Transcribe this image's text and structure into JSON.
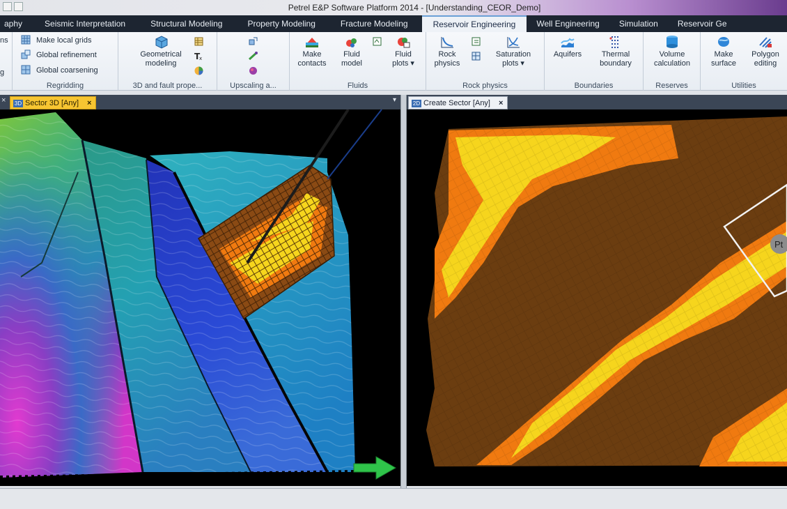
{
  "window": {
    "title": "Petrel E&P Software Platform 2014 - [Understanding_CEOR_Demo]"
  },
  "tabs": [
    {
      "label": "aphy",
      "x": 0,
      "active": false
    },
    {
      "label": "Seismic Interpretation",
      "active": false
    },
    {
      "label": "Structural Modeling",
      "active": false
    },
    {
      "label": "Property Modeling",
      "active": false
    },
    {
      "label": "Fracture Modeling",
      "active": false
    },
    {
      "label": "Reservoir Engineering",
      "active": true
    },
    {
      "label": "Well Engineering",
      "active": false
    },
    {
      "label": "Simulation",
      "active": false
    },
    {
      "label": "Reservoir Ge",
      "active": false
    }
  ],
  "ribbon": {
    "left_cut_labels": [
      "ns",
      "g"
    ],
    "regridding": {
      "label": "Regridding",
      "items": [
        "Make local grids",
        "Global refinement",
        "Global coarsening"
      ]
    },
    "fault": {
      "label": "3D and fault prope...",
      "button": "Geometrical modeling"
    },
    "upscaling": {
      "label": "Upscaling a..."
    },
    "fluids": {
      "label": "Fluids",
      "buttons": [
        "Make contacts",
        "Fluid model",
        "Fluid plots"
      ]
    },
    "rock": {
      "label": "Rock physics",
      "buttons": [
        "Rock physics",
        "Saturation plots"
      ]
    },
    "boundaries": {
      "label": "Boundaries",
      "buttons": [
        "Aquifers",
        "Thermal boundary"
      ]
    },
    "reserves": {
      "label": "Reserves",
      "buttons": [
        "Volume calculation"
      ]
    },
    "utilities": {
      "label": "Utilities",
      "buttons": [
        "Make surface",
        "Polygon editing"
      ]
    }
  },
  "documents": {
    "left": {
      "title": "Sector 3D [Any]",
      "badge": "3D"
    },
    "right": {
      "title": "Create Sector [Any]",
      "badge": "2D"
    },
    "right_marker": "Pt"
  },
  "colors": {
    "tabbar": "#1d2531",
    "ribbon": "#eef2f7",
    "active_doc_tab": "#f7c531",
    "sector_dark": "#6b3d10",
    "sector_orange": "#f07a10",
    "sector_yellow": "#f6d51d"
  }
}
